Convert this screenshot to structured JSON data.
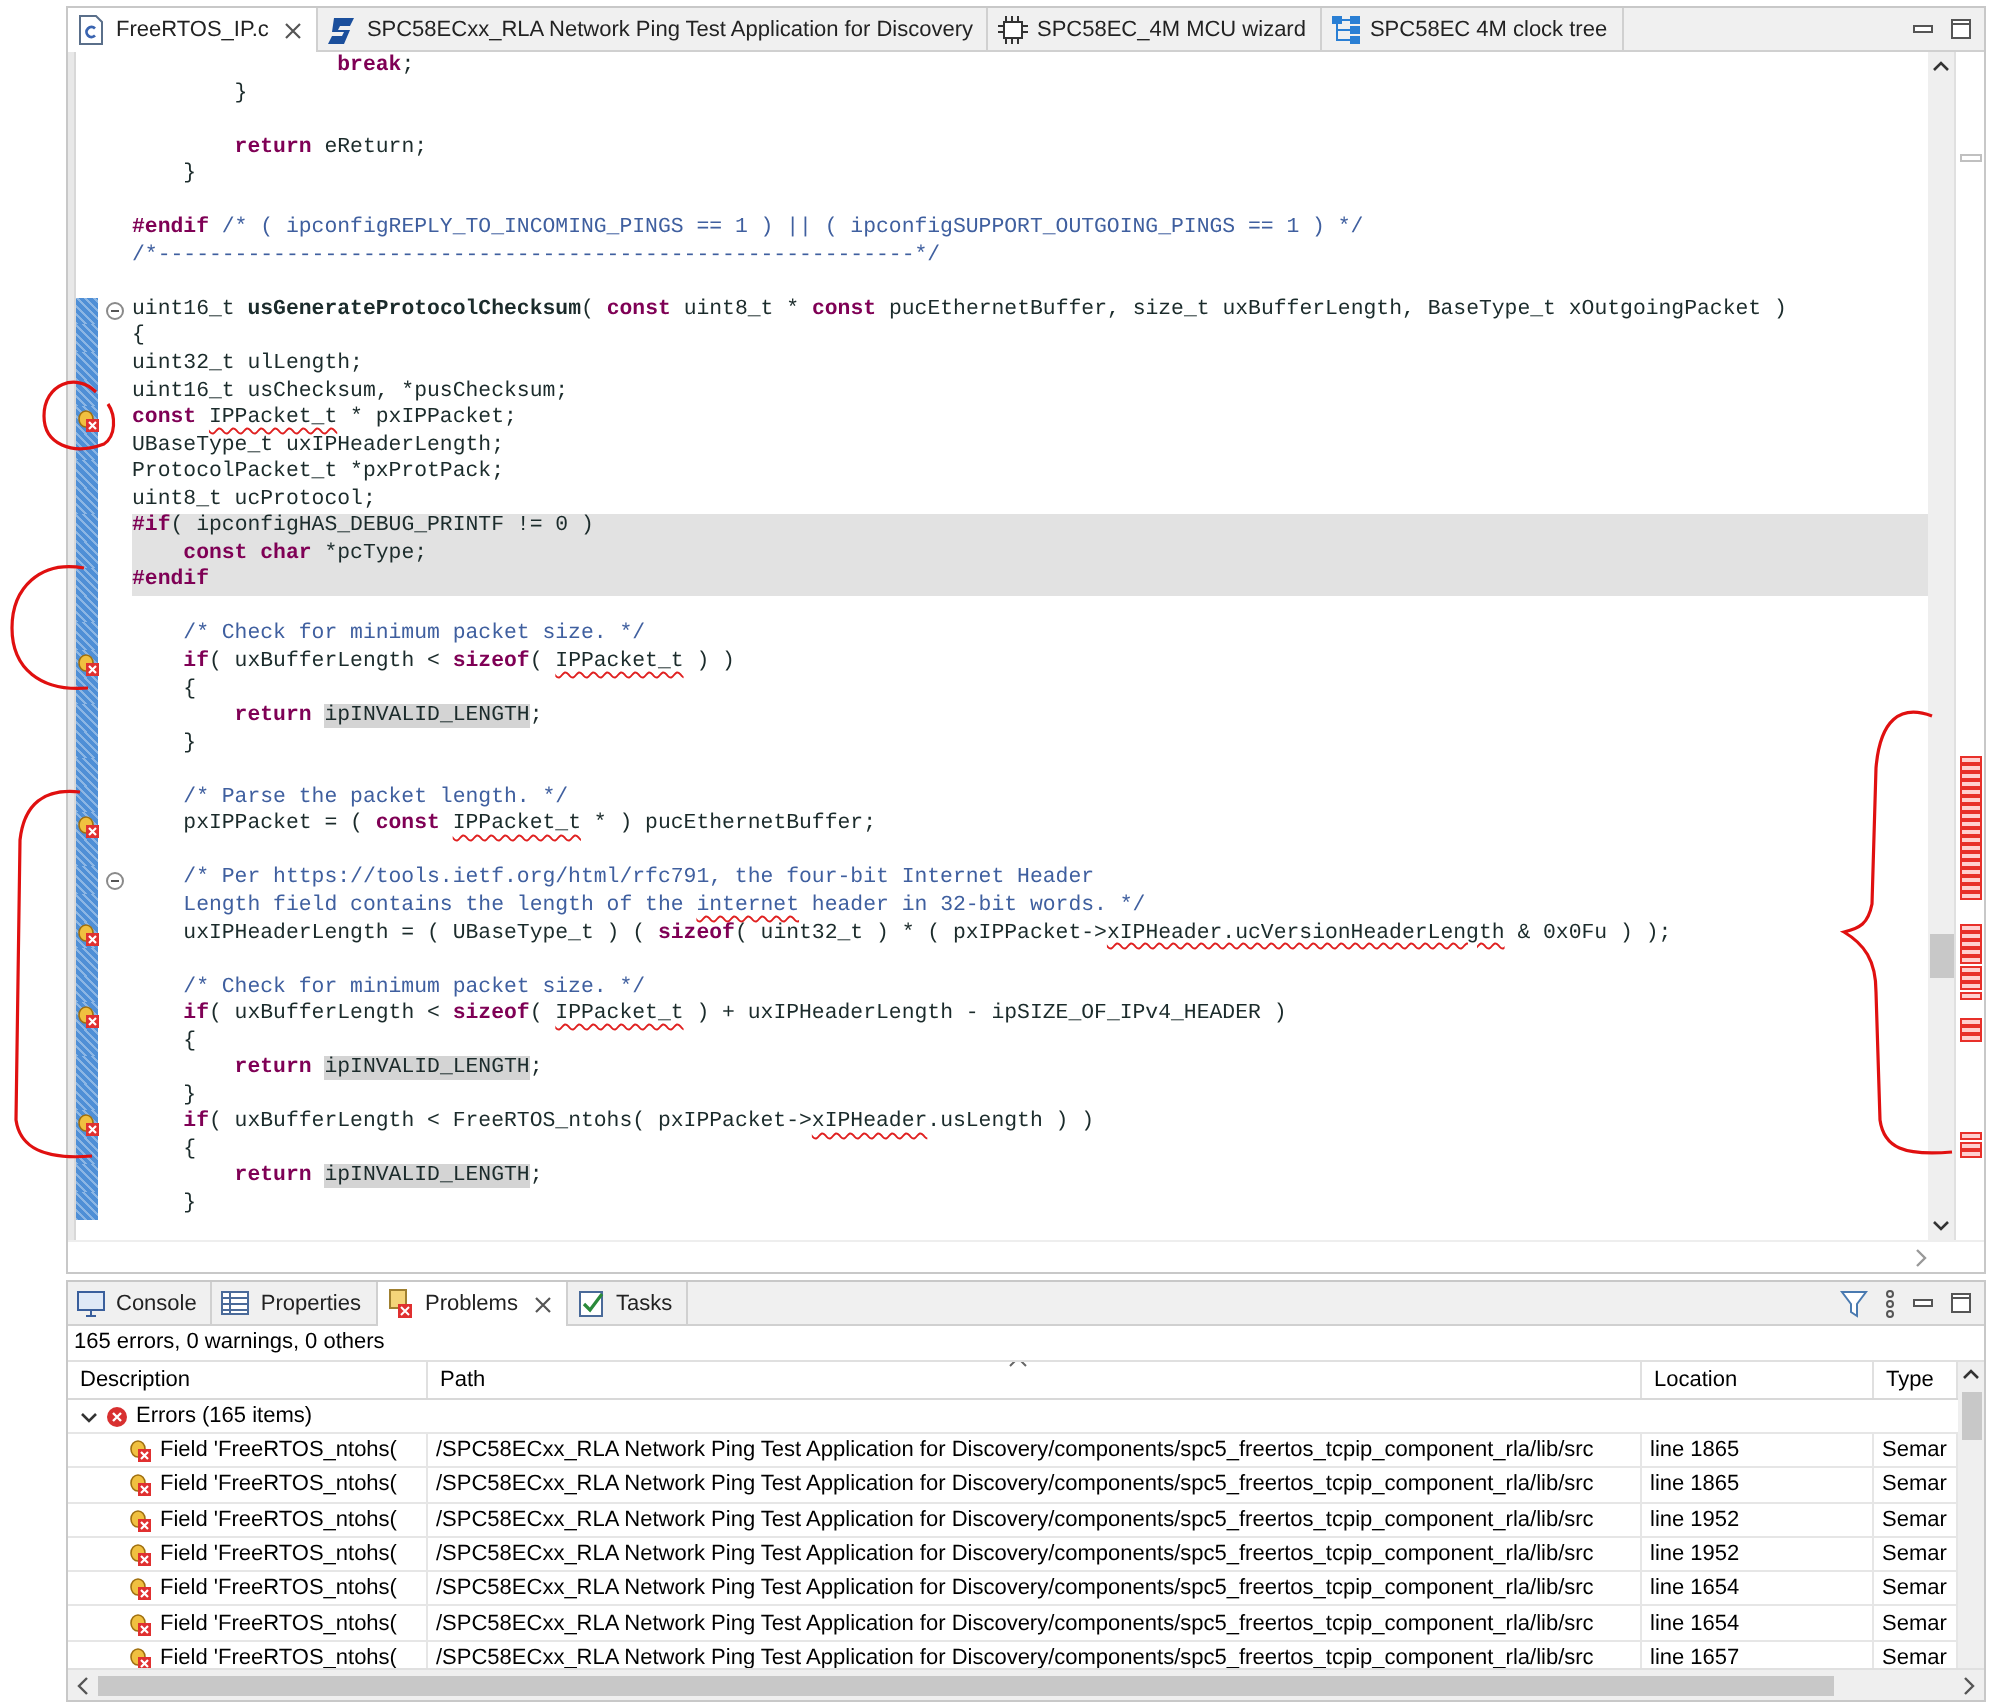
{
  "editor_tabs": [
    {
      "label": "FreeRTOS_IP.c",
      "kind": "c-file",
      "selected": true,
      "closable": true
    },
    {
      "label": "SPC58ECxx_RLA Network Ping Test Application for Discovery",
      "kind": "logo",
      "selected": false,
      "closable": false
    },
    {
      "label": "SPC58EC_4M MCU wizard",
      "kind": "chip",
      "selected": false,
      "closable": false
    },
    {
      "label": "SPC58EC 4M clock tree",
      "kind": "tree",
      "selected": false,
      "closable": false
    }
  ],
  "editor": {
    "lines": [
      {
        "marker": false,
        "fold": false,
        "shaded": false,
        "in_range": false,
        "segments": [
          {
            "text": "                break",
            "kind": "keyword"
          },
          {
            "text": ";",
            "kind": "plain"
          }
        ]
      },
      {
        "marker": false,
        "fold": false,
        "shaded": false,
        "in_range": false,
        "segments": [
          {
            "text": "        }",
            "kind": "plain"
          }
        ]
      },
      {
        "marker": false,
        "fold": false,
        "shaded": false,
        "in_range": false
      },
      {
        "marker": false,
        "fold": false,
        "shaded": false,
        "in_range": false,
        "segments": [
          {
            "text": "        return",
            "kind": "keyword"
          },
          {
            "text": " eReturn;",
            "kind": "plain"
          }
        ]
      },
      {
        "marker": false,
        "fold": false,
        "shaded": false,
        "in_range": false,
        "segments": [
          {
            "text": "    }",
            "kind": "plain"
          }
        ]
      },
      {
        "marker": false,
        "fold": false,
        "shaded": false,
        "in_range": false
      },
      {
        "marker": false,
        "fold": false,
        "shaded": false,
        "in_range": false,
        "segments": [
          {
            "text": "#endif",
            "kind": "keyword"
          },
          {
            "text": " /* ( ipconfigREPLY_TO_INCOMING_PINGS == 1 ) || ( ipconfigSUPPORT_OUTGOING_PINGS == 1 ) */",
            "kind": "comment"
          }
        ]
      },
      {
        "marker": false,
        "fold": false,
        "shaded": false,
        "in_range": false,
        "segments": [
          {
            "text": "/*-----------------------------------------------------------*/",
            "kind": "comment"
          }
        ]
      },
      {
        "marker": false,
        "fold": false,
        "shaded": false,
        "in_range": false
      },
      {
        "marker": false,
        "fold": true,
        "shaded": false,
        "in_range": true,
        "segments": [
          {
            "text": "uint16_t ",
            "kind": "plain"
          },
          {
            "text": "usGenerateProtocolChecksum",
            "kind": "name"
          },
          {
            "text": "( ",
            "kind": "plain"
          },
          {
            "text": "const",
            "kind": "keyword"
          },
          {
            "text": " uint8_t * ",
            "kind": "plain"
          },
          {
            "text": "const",
            "kind": "keyword"
          },
          {
            "text": " pucEthernetBuffer, size_t uxBufferLength, BaseType_t xOutgoingPacket )",
            "kind": "plain"
          }
        ]
      },
      {
        "marker": false,
        "fold": false,
        "shaded": false,
        "in_range": true,
        "segments": [
          {
            "text": "{",
            "kind": "plain"
          }
        ]
      },
      {
        "marker": false,
        "fold": false,
        "shaded": false,
        "in_range": true,
        "segments": [
          {
            "text": "uint32_t ulLength;",
            "kind": "plain"
          }
        ]
      },
      {
        "marker": false,
        "fold": false,
        "shaded": false,
        "in_range": true,
        "segments": [
          {
            "text": "uint16_t usChecksum, *pusChecksum;",
            "kind": "plain"
          }
        ]
      },
      {
        "marker": true,
        "fold": false,
        "shaded": false,
        "in_range": true,
        "segments": [
          {
            "text": "const ",
            "kind": "keyword"
          },
          {
            "text": "IPPacket_t",
            "kind": "error"
          },
          {
            "text": " * pxIPPacket;",
            "kind": "plain"
          }
        ]
      },
      {
        "marker": false,
        "fold": false,
        "shaded": false,
        "in_range": true,
        "segments": [
          {
            "text": "UBaseType_t uxIPHeaderLength;",
            "kind": "plain"
          }
        ]
      },
      {
        "marker": false,
        "fold": false,
        "shaded": false,
        "in_range": true,
        "segments": [
          {
            "text": "ProtocolPacket_t *pxProtPack;",
            "kind": "plain"
          }
        ]
      },
      {
        "marker": false,
        "fold": false,
        "shaded": false,
        "in_range": true,
        "segments": [
          {
            "text": "uint8_t ucProtocol;",
            "kind": "plain"
          }
        ]
      },
      {
        "marker": false,
        "fold": false,
        "shaded": true,
        "in_range": true,
        "segments": [
          {
            "text": "#if",
            "kind": "keyword"
          },
          {
            "text": "( ipconfigHAS_DEBUG_PRINTF != 0 )",
            "kind": "plain"
          }
        ]
      },
      {
        "marker": false,
        "fold": false,
        "shaded": true,
        "in_range": true,
        "segments": [
          {
            "text": "    const char",
            "kind": "keyword"
          },
          {
            "text": " *pcType;",
            "kind": "plain"
          }
        ]
      },
      {
        "marker": false,
        "fold": false,
        "shaded": true,
        "in_range": true,
        "segments": [
          {
            "text": "#endif",
            "kind": "keyword"
          }
        ]
      },
      {
        "marker": false,
        "fold": false,
        "shaded": false,
        "in_range": true
      },
      {
        "marker": false,
        "fold": false,
        "shaded": false,
        "in_range": true,
        "segments": [
          {
            "text": "    /* Check for minimum packet size. */",
            "kind": "comment"
          }
        ]
      },
      {
        "marker": true,
        "fold": false,
        "shaded": false,
        "in_range": true,
        "segments": [
          {
            "text": "    if",
            "kind": "keyword"
          },
          {
            "text": "( uxBufferLength < ",
            "kind": "plain"
          },
          {
            "text": "sizeof",
            "kind": "keyword"
          },
          {
            "text": "( ",
            "kind": "plain"
          },
          {
            "text": "IPPacket_t",
            "kind": "error"
          },
          {
            "text": " ) )",
            "kind": "plain"
          }
        ]
      },
      {
        "marker": false,
        "fold": false,
        "shaded": false,
        "in_range": true,
        "segments": [
          {
            "text": "    {",
            "kind": "plain"
          }
        ]
      },
      {
        "marker": false,
        "fold": false,
        "shaded": false,
        "in_range": true,
        "segments": [
          {
            "text": "        return ",
            "kind": "keyword"
          },
          {
            "text": "ipINVALID_LENGTH",
            "kind": "occurrence"
          },
          {
            "text": ";",
            "kind": "plain"
          }
        ]
      },
      {
        "marker": false,
        "fold": false,
        "shaded": false,
        "in_range": true,
        "segments": [
          {
            "text": "    }",
            "kind": "plain"
          }
        ]
      },
      {
        "marker": false,
        "fold": false,
        "shaded": false,
        "in_range": true
      },
      {
        "marker": false,
        "fold": false,
        "shaded": false,
        "in_range": true,
        "segments": [
          {
            "text": "    /* Parse the packet length. */",
            "kind": "comment"
          }
        ]
      },
      {
        "marker": true,
        "fold": false,
        "shaded": false,
        "in_range": true,
        "segments": [
          {
            "text": "    pxIPPacket = ( ",
            "kind": "plain"
          },
          {
            "text": "const ",
            "kind": "keyword"
          },
          {
            "text": "IPPacket_t",
            "kind": "error"
          },
          {
            "text": " * ) pucEthernetBuffer;",
            "kind": "plain"
          }
        ]
      },
      {
        "marker": false,
        "fold": false,
        "shaded": false,
        "in_range": true
      },
      {
        "marker": false,
        "fold": true,
        "shaded": false,
        "in_range": true,
        "segments": [
          {
            "text": "    /* Per https://tools.ietf.org/html/rfc791, the four-bit Internet Header",
            "kind": "comment"
          }
        ]
      },
      {
        "marker": false,
        "fold": false,
        "shaded": false,
        "in_range": true,
        "segments": [
          {
            "text": "    Length field contains the length of the ",
            "kind": "comment"
          },
          {
            "text": "internet",
            "kind": "misspelled"
          },
          {
            "text": " header in 32-bit words. */",
            "kind": "comment"
          }
        ]
      },
      {
        "marker": true,
        "fold": false,
        "shaded": false,
        "in_range": true,
        "segments": [
          {
            "text": "    uxIPHeaderLength = ( UBaseType_t ) ( ",
            "kind": "plain"
          },
          {
            "text": "sizeof",
            "kind": "keyword"
          },
          {
            "text": "( uint32_t ) * ( pxIPPacket->",
            "kind": "plain"
          },
          {
            "text": "xIPHeader.ucVersionHeaderLength",
            "kind": "error"
          },
          {
            "text": " & 0x0Fu ) );",
            "kind": "plain"
          }
        ]
      },
      {
        "marker": false,
        "fold": false,
        "shaded": false,
        "in_range": true
      },
      {
        "marker": false,
        "fold": false,
        "shaded": false,
        "in_range": true,
        "segments": [
          {
            "text": "    /* Check for minimum packet size. */",
            "kind": "comment"
          }
        ]
      },
      {
        "marker": true,
        "fold": false,
        "shaded": false,
        "in_range": true,
        "segments": [
          {
            "text": "    if",
            "kind": "keyword"
          },
          {
            "text": "( uxBufferLength < ",
            "kind": "plain"
          },
          {
            "text": "sizeof",
            "kind": "keyword"
          },
          {
            "text": "( ",
            "kind": "plain"
          },
          {
            "text": "IPPacket_t",
            "kind": "error"
          },
          {
            "text": " ) + uxIPHeaderLength - ipSIZE_OF_IPv4_HEADER )",
            "kind": "plain"
          }
        ]
      },
      {
        "marker": false,
        "fold": false,
        "shaded": false,
        "in_range": true,
        "segments": [
          {
            "text": "    {",
            "kind": "plain"
          }
        ]
      },
      {
        "marker": false,
        "fold": false,
        "shaded": false,
        "in_range": true,
        "segments": [
          {
            "text": "        return ",
            "kind": "keyword"
          },
          {
            "text": "ipINVALID_LENGTH",
            "kind": "occurrence"
          },
          {
            "text": ";",
            "kind": "plain"
          }
        ]
      },
      {
        "marker": false,
        "fold": false,
        "shaded": false,
        "in_range": true,
        "segments": [
          {
            "text": "    }",
            "kind": "plain"
          }
        ]
      },
      {
        "marker": true,
        "fold": false,
        "shaded": false,
        "in_range": true,
        "segments": [
          {
            "text": "    if",
            "kind": "keyword"
          },
          {
            "text": "( uxBufferLength < FreeRTOS_ntohs( pxIPPacket->",
            "kind": "plain"
          },
          {
            "text": "xIPHeader",
            "kind": "error"
          },
          {
            "text": ".usLength ) )",
            "kind": "plain"
          }
        ]
      },
      {
        "marker": false,
        "fold": false,
        "shaded": false,
        "in_range": true,
        "segments": [
          {
            "text": "    {",
            "kind": "plain"
          }
        ]
      },
      {
        "marker": false,
        "fold": false,
        "shaded": false,
        "in_range": true,
        "segments": [
          {
            "text": "        return ",
            "kind": "keyword"
          },
          {
            "text": "ipINVALID_LENGTH",
            "kind": "occurrence"
          },
          {
            "text": ";",
            "kind": "plain"
          }
        ]
      },
      {
        "marker": false,
        "fold": false,
        "shaded": false,
        "in_range": true,
        "segments": [
          {
            "text": "    }",
            "kind": "plain"
          }
        ]
      }
    ]
  },
  "panel": {
    "tabs": [
      {
        "label": "Console",
        "kind": "console",
        "selected": false,
        "closable": false
      },
      {
        "label": "Properties",
        "kind": "properties",
        "selected": false,
        "closable": false
      },
      {
        "label": "Problems",
        "kind": "problems",
        "selected": true,
        "closable": true
      },
      {
        "label": "Tasks",
        "kind": "tasks",
        "selected": false,
        "closable": false
      }
    ],
    "summary": "165 errors, 0 warnings, 0 others",
    "columns": [
      "Description",
      "Path",
      "Location",
      "Type"
    ],
    "group": {
      "label": "Errors (165 items)",
      "expanded": true
    },
    "rows": [
      {
        "description": "Field 'FreeRTOS_ntohs(",
        "path": "/SPC58ECxx_RLA Network Ping Test Application for Discovery/components/spc5_freertos_tcpip_component_rla/lib/src",
        "location": "line 1865",
        "type": "Semar"
      },
      {
        "description": "Field 'FreeRTOS_ntohs(",
        "path": "/SPC58ECxx_RLA Network Ping Test Application for Discovery/components/spc5_freertos_tcpip_component_rla/lib/src",
        "location": "line 1865",
        "type": "Semar"
      },
      {
        "description": "Field 'FreeRTOS_ntohs(",
        "path": "/SPC58ECxx_RLA Network Ping Test Application for Discovery/components/spc5_freertos_tcpip_component_rla/lib/src",
        "location": "line 1952",
        "type": "Semar"
      },
      {
        "description": "Field 'FreeRTOS_ntohs(",
        "path": "/SPC58ECxx_RLA Network Ping Test Application for Discovery/components/spc5_freertos_tcpip_component_rla/lib/src",
        "location": "line 1952",
        "type": "Semar"
      },
      {
        "description": "Field 'FreeRTOS_ntohs(",
        "path": "/SPC58ECxx_RLA Network Ping Test Application for Discovery/components/spc5_freertos_tcpip_component_rla/lib/src",
        "location": "line 1654",
        "type": "Semar"
      },
      {
        "description": "Field 'FreeRTOS_ntohs(",
        "path": "/SPC58ECxx_RLA Network Ping Test Application for Discovery/components/spc5_freertos_tcpip_component_rla/lib/src",
        "location": "line 1654",
        "type": "Semar"
      },
      {
        "description": "Field 'FreeRTOS_ntohs(",
        "path": "/SPC58ECxx_RLA Network Ping Test Application for Discovery/components/spc5_freertos_tcpip_component_rla/lib/src",
        "location": "line 1657",
        "type": "Semar"
      }
    ]
  }
}
